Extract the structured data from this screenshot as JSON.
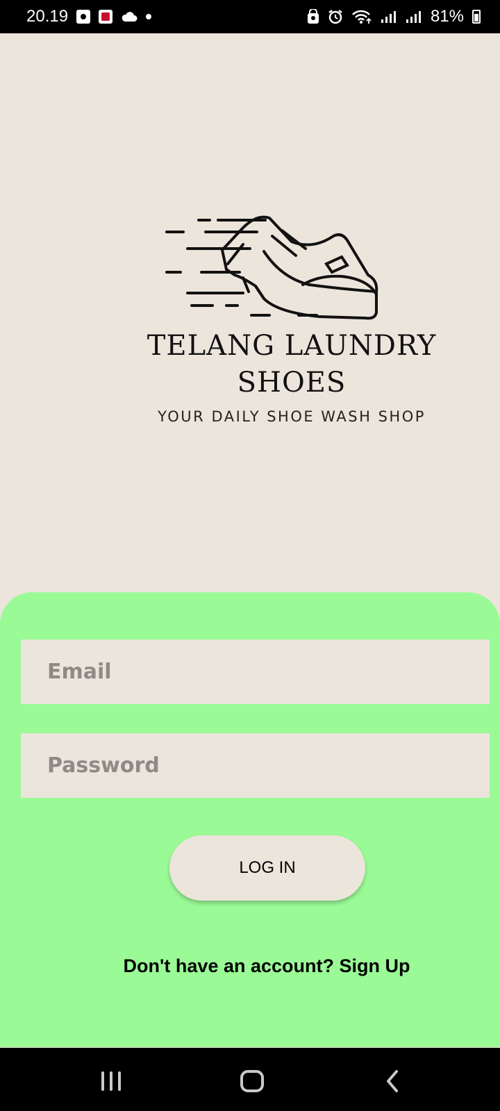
{
  "status_bar": {
    "time": "20.19",
    "battery": "81%"
  },
  "brand": {
    "name_line1": "TELANG LAUNDRY",
    "name_line2": "SHOES",
    "tagline": "YOUR DAILY SHOE WASH SHOP"
  },
  "form": {
    "email_placeholder": "Email",
    "password_placeholder": "Password",
    "login_label": "LOG IN",
    "signup_text": "Don't have an account? Sign Up"
  },
  "colors": {
    "background": "#ece5dc",
    "panel": "#9afa96"
  },
  "icons": {
    "status_left": [
      "notification-icon",
      "app-icon",
      "cloud-icon",
      "dot-icon"
    ],
    "status_right": [
      "face-unlock-icon",
      "alarm-icon",
      "wifi-icon",
      "signal-icon",
      "signal-icon",
      "battery-icon"
    ],
    "navigation": [
      "recents-icon",
      "home-icon",
      "back-icon"
    ]
  }
}
